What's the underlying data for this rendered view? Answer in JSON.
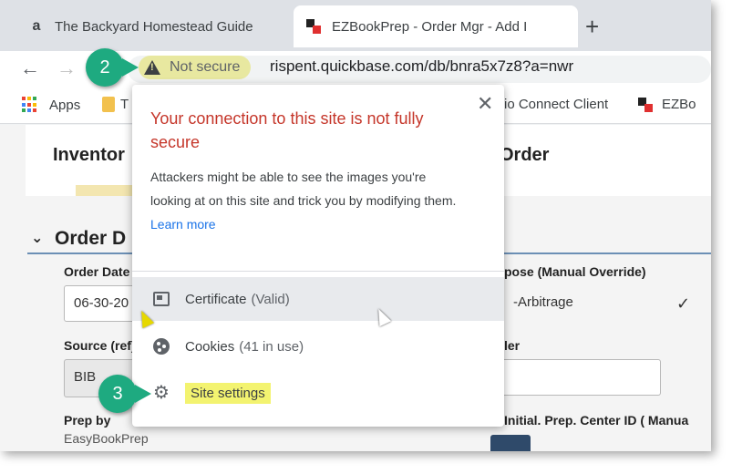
{
  "tabs": [
    {
      "title": "The Backyard Homestead Guide",
      "favicon": "amazon-icon",
      "favicon_glyph": "a",
      "active": false
    },
    {
      "title": "EZBookPrep - Order Mgr - Add I",
      "favicon": "ezbookprep-icon",
      "active": true
    }
  ],
  "toolbar": {
    "back_glyph": "←",
    "forward_glyph": "→",
    "security_label": "Not secure",
    "url": "rispent.quickbase.com/db/bnra5x7z8?a=nwr"
  },
  "bookmarks": [
    {
      "label": "Apps",
      "icon": "apps-grid-icon"
    },
    {
      "label": "T",
      "icon": "folder-icon"
    },
    {
      "label": "rio Connect Client",
      "icon": ""
    },
    {
      "label": "EZBo",
      "icon": "ezbookprep-icon"
    }
  ],
  "page": {
    "heading_left": "Inventor",
    "heading_right": "Order",
    "section_title": "Order D",
    "section_chevron": "⌄",
    "order_date_label": "Order Date",
    "order_date_value": "06-30-20",
    "purpose_label": "pose (Manual Override)",
    "purpose_value": "-Arbitrage",
    "purpose_check": "✓",
    "source_label": "Source (ref)",
    "source_value": "BIB",
    "right_label": "ler",
    "prep_label": "Prep by",
    "prep_value": "EasyBookPrep",
    "initial_label": "Initial. Prep. Center ID ( Manua"
  },
  "popup": {
    "title": "Your connection to this site is not fully secure",
    "body": "Attackers might be able to see the images you're looking at on this site and trick you by modifying them.",
    "learn_more": "Learn more",
    "close_glyph": "✕",
    "certificate_label": "Certificate",
    "certificate_status": "(Valid)",
    "cookies_label": "Cookies",
    "cookies_status": "(41 in use)",
    "site_settings_label": "Site settings",
    "gear_glyph": "⚙"
  },
  "callouts": [
    {
      "number": "2",
      "color": "#1eaa80"
    },
    {
      "number": "3",
      "color": "#1eaa80"
    }
  ],
  "colors": {
    "warning_title": "#c5362a",
    "link": "#1a73e8",
    "highlight": "#f3f370",
    "callout": "#1eaa80"
  }
}
